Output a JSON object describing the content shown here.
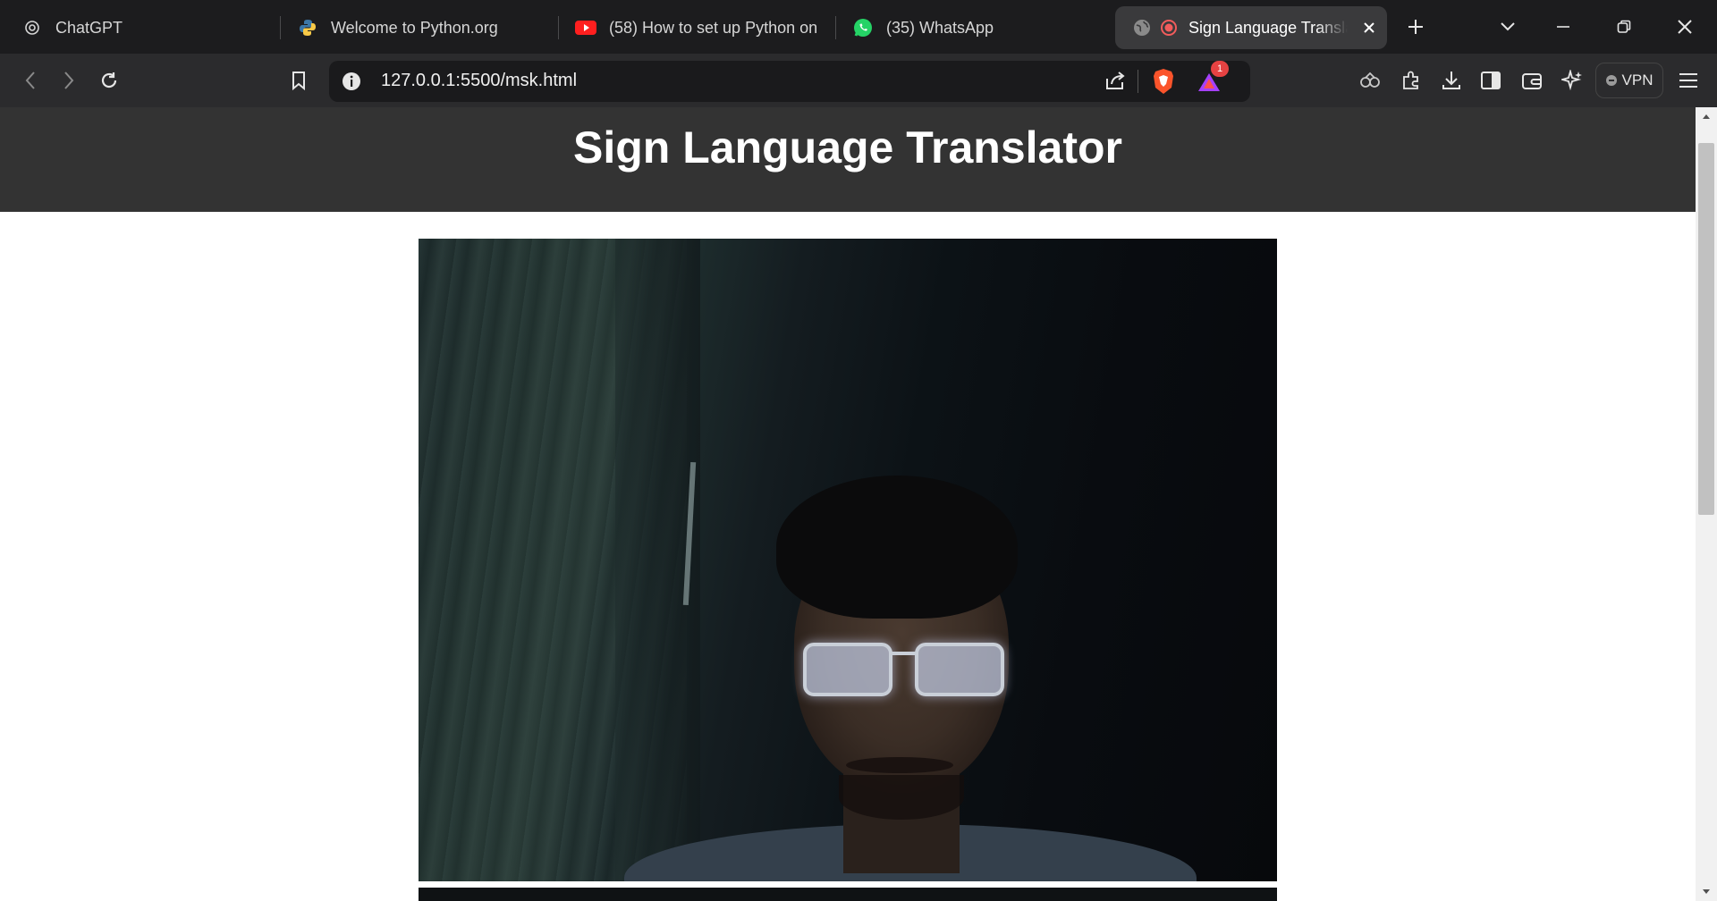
{
  "browser": {
    "tabs": [
      {
        "title": "ChatGPT",
        "icon": "chatgpt-icon"
      },
      {
        "title": "Welcome to Python.org",
        "icon": "python-icon"
      },
      {
        "title": "(58) How to set up Python on",
        "icon": "youtube-icon"
      },
      {
        "title": "(35) WhatsApp",
        "icon": "whatsapp-icon"
      },
      {
        "title": "Sign Language Transla",
        "icon": "globe-icon",
        "active": true
      }
    ],
    "url": "127.0.0.1:5500/msk.html",
    "rewards_badge": "1",
    "vpn_label": "VPN"
  },
  "page": {
    "title": "Sign Language Translator"
  },
  "colors": {
    "header_bg": "#333333",
    "tabstrip_bg": "#1c1c1e",
    "toolbar_bg": "#2b2b2d"
  }
}
